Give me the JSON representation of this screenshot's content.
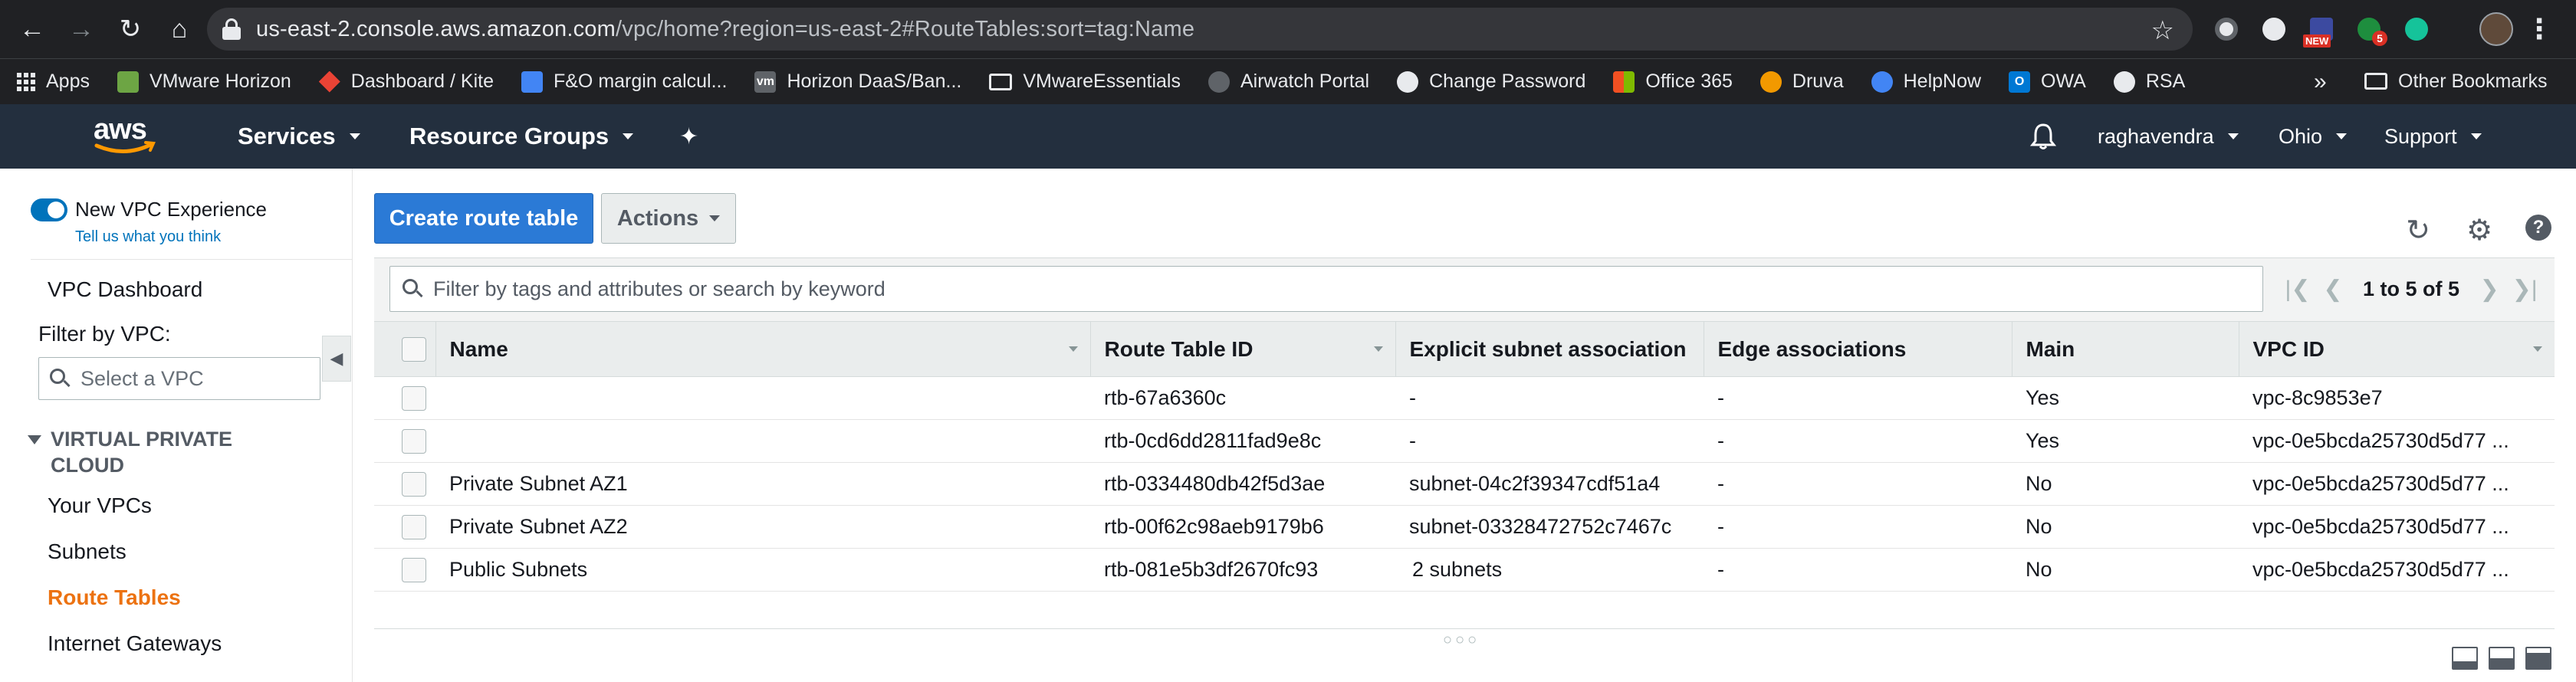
{
  "browser": {
    "url_host": "us-east-2.console.aws.amazon.com",
    "url_path": "/vpc/home?region=us-east-2#RouteTables:sort=tag:Name",
    "ext_badge_new": "NEW",
    "ext_badge_count": "5",
    "icons": [
      "back-icon",
      "forward-icon",
      "reload-icon",
      "home-icon",
      "lock-icon",
      "star-icon",
      "kebab-menu-icon"
    ]
  },
  "bookmarks": {
    "items": [
      {
        "label": "Apps",
        "icon": "apps-grid-icon",
        "color": "#e8eaed"
      },
      {
        "label": "VMware Horizon",
        "icon": "vmware-horizon-icon",
        "color": "#6da544"
      },
      {
        "label": "Dashboard / Kite",
        "icon": "kite-icon",
        "color": "#ea4335"
      },
      {
        "label": "F&O margin calcul...",
        "icon": "document-icon",
        "color": "#4285f4"
      },
      {
        "label": "Horizon DaaS/Ban...",
        "icon": "vm-icon",
        "color": "#5f6368"
      },
      {
        "label": "VMwareEssentials",
        "icon": "folder-icon",
        "color": "#e8eaed"
      },
      {
        "label": "Airwatch Portal",
        "icon": "airwatch-icon",
        "color": "#5f6368"
      },
      {
        "label": "Change Password",
        "icon": "globe-icon",
        "color": "#e8eaed"
      },
      {
        "label": "Office 365",
        "icon": "office-icon",
        "color": "#f25022"
      },
      {
        "label": "Druva",
        "icon": "druva-icon",
        "color": "#f29900"
      },
      {
        "label": "HelpNow",
        "icon": "helpnow-icon",
        "color": "#4285f4"
      },
      {
        "label": "OWA",
        "icon": "outlook-icon",
        "color": "#0078d4"
      },
      {
        "label": "RSA",
        "icon": "rsa-icon",
        "color": "#e8eaed"
      }
    ],
    "overflow": "»",
    "other": "Other Bookmarks"
  },
  "aws": {
    "logo": "aws",
    "services": "Services",
    "resource_groups": "Resource Groups",
    "user": "raghavendra",
    "region": "Ohio",
    "support": "Support",
    "colors": {
      "header_bg": "#232f3e",
      "logo_smile": "#ff9900"
    }
  },
  "sidebar": {
    "toggle_label": "New VPC Experience",
    "feedback": "Tell us what you think",
    "dashboard": "VPC Dashboard",
    "filter_label": "Filter by VPC:",
    "select_placeholder": "Select a VPC",
    "section_title": "VIRTUAL PRIVATE CLOUD",
    "items": [
      {
        "label": "Your VPCs",
        "active": false
      },
      {
        "label": "Subnets",
        "active": false
      },
      {
        "label": "Route Tables",
        "active": true
      },
      {
        "label": "Internet Gateways",
        "active": false
      }
    ],
    "colors": {
      "active": "#ec7211",
      "toggle_on": "#0073bb"
    }
  },
  "main": {
    "create_button": "Create route table",
    "actions_button": "Actions",
    "filter_placeholder": "Filter by tags and attributes or search by keyword",
    "pagination": "1 to 5 of 5",
    "columns": [
      "Name",
      "Route Table ID",
      "Explicit subnet association",
      "Edge associations",
      "Main",
      "VPC ID"
    ],
    "rows": [
      {
        "name": "",
        "rtb": "rtb-67a6360c",
        "subnet": "-",
        "subnet_link": false,
        "edge": "-",
        "main": "Yes",
        "vpc": "vpc-8c9853e7"
      },
      {
        "name": "",
        "rtb": "rtb-0cd6dd2811fad9e8c",
        "subnet": "-",
        "subnet_link": false,
        "edge": "-",
        "main": "Yes",
        "vpc": "vpc-0e5bcda25730d5d77 ..."
      },
      {
        "name": "Private Subnet AZ1",
        "rtb": "rtb-0334480db42f5d3ae",
        "subnet": "subnet-04c2f39347cdf51a4",
        "subnet_link": false,
        "edge": "-",
        "main": "No",
        "vpc": "vpc-0e5bcda25730d5d77 ..."
      },
      {
        "name": "Private Subnet AZ2",
        "rtb": "rtb-00f62c98aeb9179b6",
        "subnet": "subnet-03328472752c7467c",
        "subnet_link": false,
        "edge": "-",
        "main": "No",
        "vpc": "vpc-0e5bcda25730d5d77 ..."
      },
      {
        "name": "Public Subnets",
        "rtb": "rtb-081e5b3df2670fc93",
        "subnet": "2 subnets",
        "subnet_link": true,
        "edge": "-",
        "main": "No",
        "vpc": "vpc-0e5bcda25730d5d77 ..."
      }
    ],
    "colors": {
      "primary": "#2b7ad6",
      "link": "#0073bb"
    }
  }
}
